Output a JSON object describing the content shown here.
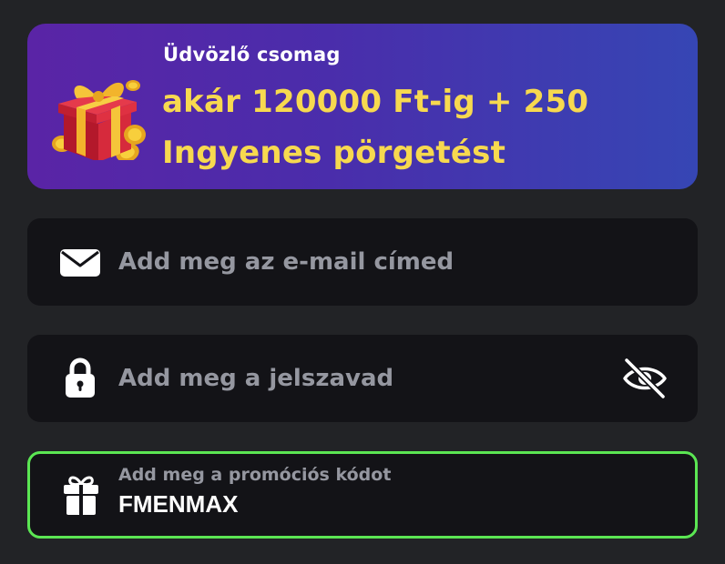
{
  "banner": {
    "subtitle": "Üdvözlő csomag",
    "title_line1": "akár 120000 Ft-ig + 250",
    "title_line2": "Ingyenes pörgetést",
    "icon": "gift-box-icon",
    "title_color": "#f7d94f"
  },
  "form": {
    "email": {
      "placeholder": "Add meg az e-mail címed",
      "icon": "envelope-icon"
    },
    "password": {
      "placeholder": "Add meg a jelszavad",
      "icon": "lock-icon",
      "toggle_icon": "eye-off-icon"
    },
    "promo": {
      "label": "Add meg a promóciós kódot",
      "value": "FMENMAX",
      "icon": "gift-icon",
      "border_color": "#5be653"
    }
  }
}
